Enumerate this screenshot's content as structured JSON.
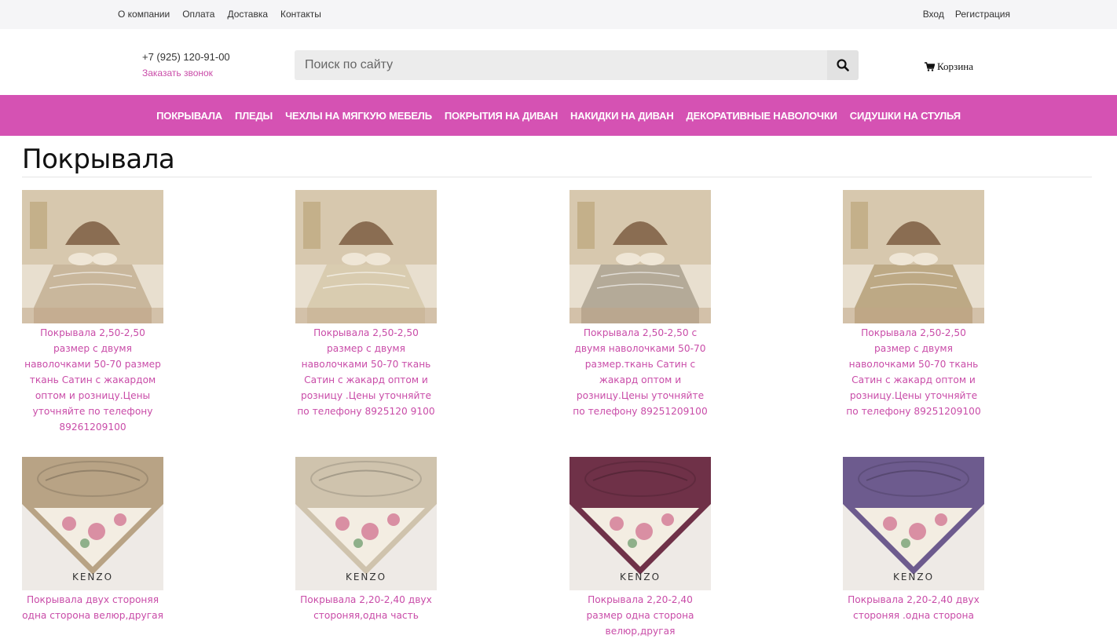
{
  "topbar": {
    "links": [
      "О компании",
      "Оплата",
      "Доставка",
      "Контакты"
    ],
    "auth": [
      "Вход",
      "Регистрация"
    ]
  },
  "header": {
    "phone": "+7 (925) 120-91-00",
    "callback": "Заказать звонок",
    "search_placeholder": "Поиск по сайту",
    "cart_label": "Корзина"
  },
  "nav": [
    "ПОКРЫВАЛА",
    "ПЛЕДЫ",
    "ЧЕХЛЫ НА МЯГКУЮ МЕБЕЛЬ",
    "ПОКРЫТИЯ НА ДИВАН",
    "НАКИДКИ НА ДИВАН",
    "ДЕКОРАТИВНЫЕ НАВОЛОЧКИ",
    "СИДУШКИ НА СТУЛЬЯ"
  ],
  "page_title": "Покрывала",
  "products": [
    {
      "caption": "Покрывала 2,50-2,50 размер с двумя наволочками 50-70 размер ткань Сатин с жакардом оптом и розницу.Цены уточняйте по телефону 89261209100",
      "image": "bedroom-bedspread-beige",
      "tone": "#c9b79c"
    },
    {
      "caption": "Покрывала 2,50-2,50 размер с двумя наволочками 50-70 ткань Сатин с жакард оптом и розницу .Цены уточняйте по телефону 8925120 9100",
      "image": "bedroom-bedspread-cream",
      "tone": "#d9ccb0"
    },
    {
      "caption": "Покрывала 2,50-2,50 с двумя наволочками 50-70 размер.ткань Сатин с жакард оптом и розницу.Цены уточняйте по телефону 89251209100",
      "image": "bedroom-bedspread-grey",
      "tone": "#b4aa98"
    },
    {
      "caption": "Покрывала 2,50-2,50 размер с двумя наволочками 50-70 ткань Сатин с жакард оптом и розницу.Цены уточняйте по телефону 89251209100",
      "image": "bedroom-bedspread-gold",
      "tone": "#bda985"
    },
    {
      "caption": "Покрывала двух стороняя одна сторона велюр,другая",
      "image": "kenzo-velour-beige",
      "tone": "#b8a385",
      "brand": "KENZO"
    },
    {
      "caption": "Покрывала 2,20-2,40 двух стороняя,одна часть",
      "image": "kenzo-velour-cream",
      "tone": "#cfc3ad",
      "brand": "KENZO"
    },
    {
      "caption": "Покрывала 2,20-2,40 размер одна сторона велюр,другая",
      "image": "kenzo-velour-plum",
      "tone": "#6f3148",
      "brand": "KENZO"
    },
    {
      "caption": "Покрывала 2,20-2,40 двух стороняя .одна сторона",
      "image": "kenzo-velour-violet",
      "tone": "#6d5b8e",
      "brand": "KENZO"
    }
  ]
}
